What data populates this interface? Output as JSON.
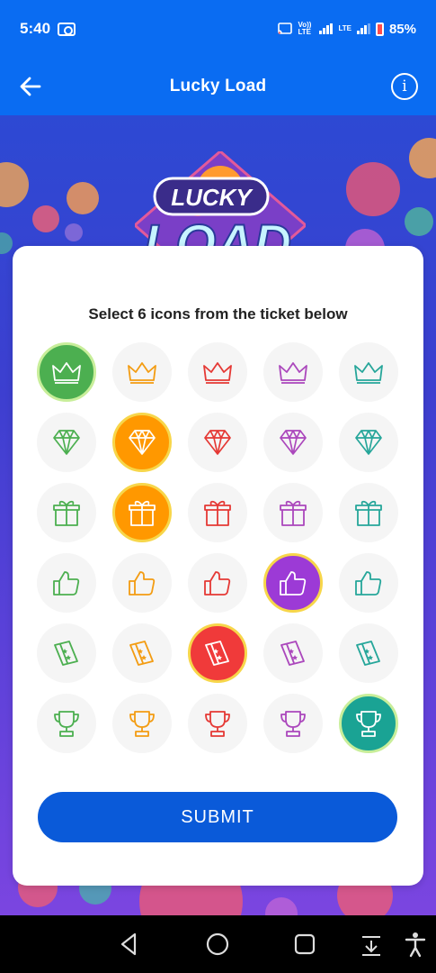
{
  "status": {
    "time": "5:40",
    "battery": "85%",
    "volte1": "Vo)) LTE",
    "volte2": "LTE"
  },
  "header": {
    "title": "Lucky Load",
    "back_icon": "arrow-left-icon",
    "info_icon": "info-icon"
  },
  "logo": {
    "line1": "LUCKY",
    "line2": "LOAD"
  },
  "ticket": {
    "instruction": "Select 6 icons from the ticket below",
    "rows": [
      {
        "icon": "crown"
      },
      {
        "icon": "diamond"
      },
      {
        "icon": "gift"
      },
      {
        "icon": "thumbs-up"
      },
      {
        "icon": "ticket"
      },
      {
        "icon": "trophy"
      }
    ],
    "column_colors": [
      "#4caf50",
      "#f39c12",
      "#e53935",
      "#ab47bc",
      "#26a69a"
    ],
    "selected": [
      {
        "row": 0,
        "col": 0
      },
      {
        "row": 1,
        "col": 1
      },
      {
        "row": 2,
        "col": 1
      },
      {
        "row": 3,
        "col": 3
      },
      {
        "row": 4,
        "col": 2
      },
      {
        "row": 5,
        "col": 4
      }
    ],
    "submit_label": "SUBMIT"
  },
  "colors": {
    "primary": "#0a6cf2",
    "button": "#0a5ad9",
    "selected_border": "#f7d64a",
    "selected_orange": "#ff9800"
  },
  "nav": {
    "back_icon": "nav-back-icon",
    "home_icon": "nav-home-icon",
    "recents_icon": "nav-recents-icon",
    "down_icon": "nav-down-icon",
    "accessibility_icon": "accessibility-icon"
  }
}
